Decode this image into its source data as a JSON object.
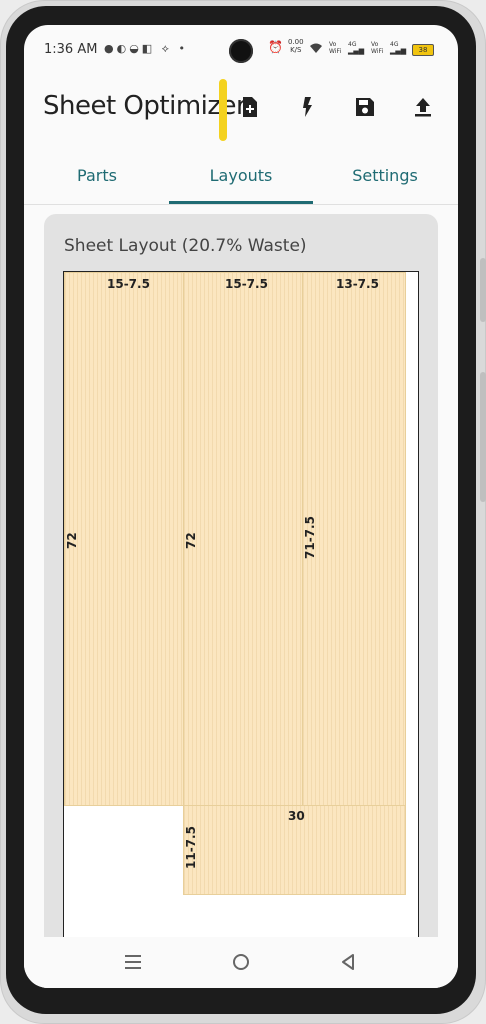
{
  "status_bar": {
    "time": "1:36 AM",
    "speed_value": "0.00",
    "speed_unit": "K/S",
    "sim1_label": "Vo WiFi",
    "sim1_net": "4G",
    "sim2_label": "Vo WiFi",
    "sim2_net": "4G",
    "battery": "38"
  },
  "app_bar": {
    "title": "Sheet Optimizer",
    "icons": [
      "new-file-icon",
      "flash-icon",
      "save-icon",
      "upload-icon"
    ]
  },
  "tabs": [
    {
      "label": "Parts",
      "active": false
    },
    {
      "label": "Layouts",
      "active": true
    },
    {
      "label": "Settings",
      "active": false
    }
  ],
  "layout_card": {
    "title": "Sheet Layout (20.7% Waste)",
    "parts": [
      {
        "width_label": "15-7.5",
        "height_label": "72"
      },
      {
        "width_label": "15-7.5",
        "height_label": "72"
      },
      {
        "width_label": "13-7.5",
        "height_label": "71-7.5"
      },
      {
        "width_label": "30",
        "height_label": "11-7.5"
      }
    ]
  },
  "nav_bar": {
    "buttons": [
      "recents-icon",
      "home-icon",
      "back-icon"
    ]
  },
  "colors": {
    "accent": "#1f6b73",
    "part_fill": "#fbe6c0",
    "highlight": "#f4d21f"
  }
}
